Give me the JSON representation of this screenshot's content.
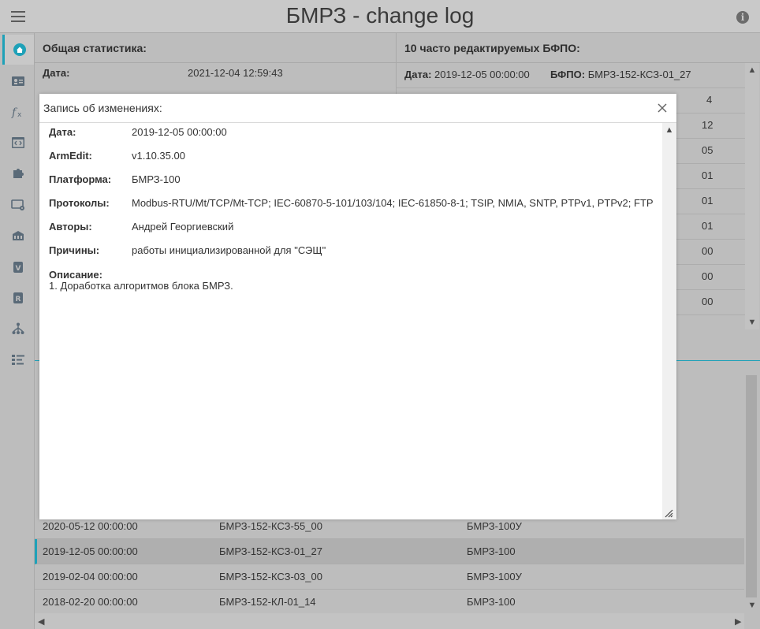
{
  "header": {
    "title": "БМРЗ - change log",
    "info_icon": "info-icon"
  },
  "sidebar": {
    "items": [
      {
        "icon": "home-icon",
        "active": true
      },
      {
        "icon": "id-card-icon"
      },
      {
        "icon": "function-icon"
      },
      {
        "icon": "code-window-icon"
      },
      {
        "icon": "puzzle-icon"
      },
      {
        "icon": "screen-settings-icon"
      },
      {
        "icon": "building-icon"
      },
      {
        "icon": "v-badge-icon",
        "text": "V"
      },
      {
        "icon": "r-badge-icon",
        "text": "R"
      },
      {
        "icon": "hierarchy-icon"
      },
      {
        "icon": "list-icon"
      }
    ]
  },
  "stats_panel": {
    "title": "Общая статистика:",
    "date_label": "Дата:",
    "date_value": "2021-12-04 12:59:43"
  },
  "frequent_panel": {
    "title": "10 часто редактируемых БФПО:",
    "first_row": {
      "date_label": "Дата:",
      "date_value": "2019-12-05 00:00:00",
      "bfpo_label": "БФПО:",
      "bfpo_value": "БМРЗ-152-КСЗ-01_27"
    },
    "visible_tails": [
      "4",
      "12",
      "05",
      "01",
      "01",
      "01",
      "00",
      "00",
      "00"
    ]
  },
  "bottom_table": {
    "rows": [
      {
        "date": "2020-05-12 00:00:00",
        "bfpo": "БМРЗ-152-КСЗ-55_00",
        "platform": "БМРЗ-100У",
        "selected": false
      },
      {
        "date": "2019-12-05 00:00:00",
        "bfpo": "БМРЗ-152-КСЗ-01_27",
        "platform": "БМРЗ-100",
        "selected": true
      },
      {
        "date": "2019-02-04 00:00:00",
        "bfpo": "БМРЗ-152-КСЗ-03_00",
        "platform": "БМРЗ-100У",
        "selected": false
      },
      {
        "date": "2018-02-20 00:00:00",
        "bfpo": "БМРЗ-152-КЛ-01_14",
        "platform": "БМРЗ-100",
        "selected": false
      }
    ]
  },
  "modal": {
    "title": "Запись об изменениях:",
    "fields": [
      {
        "label": "Дата:",
        "value": "2019-12-05 00:00:00"
      },
      {
        "label": "ArmEdit:",
        "value": "v1.10.35.00"
      },
      {
        "label": "Платформа:",
        "value": "БМРЗ-100"
      },
      {
        "label": "Протоколы:",
        "value": "Modbus-RTU/Mt/TCP/Mt-TCP; IEC-60870-5-101/103/104; IEC-61850-8-1; TSIP, NMIA, SNTP, PTPv1, PTPv2; FTP"
      },
      {
        "label": "Авторы:",
        "value": "Андрей Георгиевский"
      },
      {
        "label": "Причины:",
        "value": "работы инициализированной для \"СЭЩ\""
      }
    ],
    "description_label": "Описание:",
    "description_text": "1. Доработка алгоритмов блока БМРЗ."
  },
  "colors": {
    "accent": "#1ea1b8",
    "overlay_bg": "#bdbdbd",
    "modal_bg": "#ffffff"
  }
}
